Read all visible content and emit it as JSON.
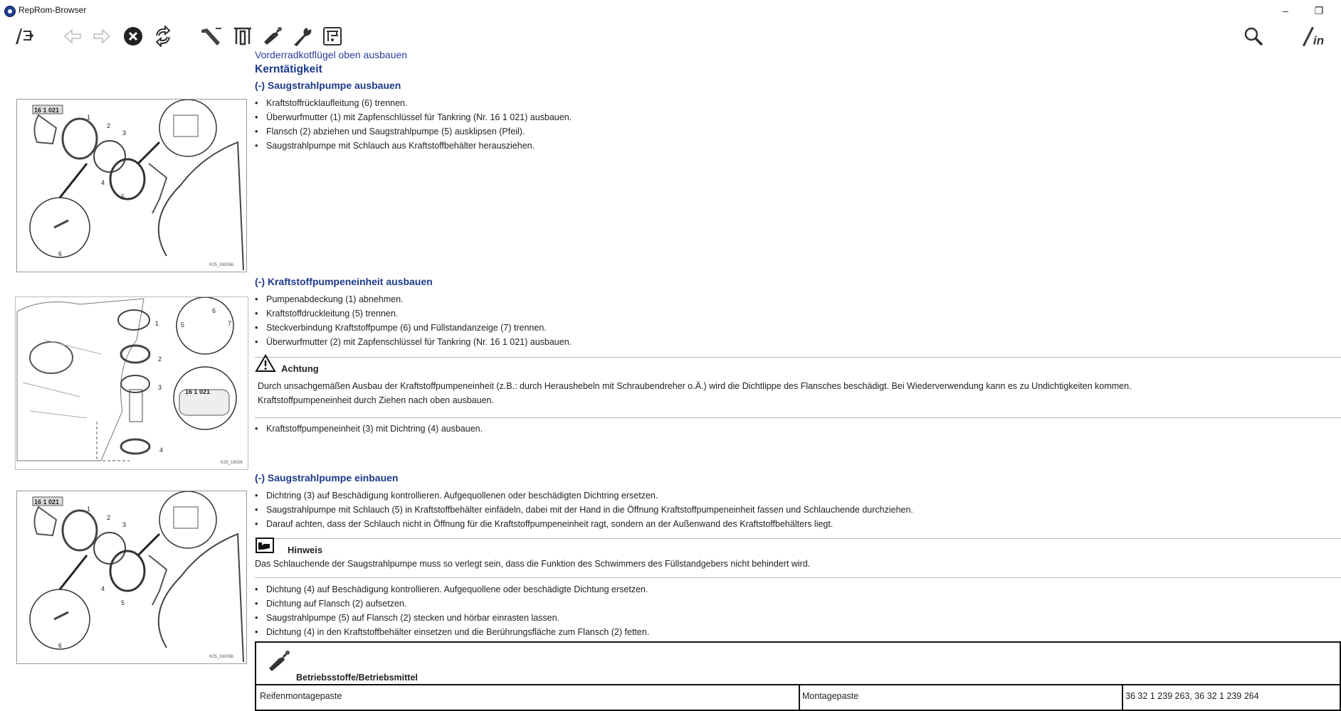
{
  "window": {
    "title": "RepRom-Browser",
    "minimize": "–",
    "restore": "❐"
  },
  "toolbar": {
    "icons": [
      "exit-icon",
      "back-arrow-icon",
      "forward-arrow-icon",
      "stop-icon",
      "refresh-icon",
      "tool1-icon",
      "tool2-icon",
      "grease-gun-icon",
      "wrench-icon",
      "specs-icon",
      "search-icon",
      "info-pen-icon"
    ]
  },
  "page": {
    "breadcrumb": "Vorderradkotflügel oben ausbauen",
    "heading": "Kerntätigkeit",
    "sections": [
      {
        "title": "(-) Saugstrahlpumpe ausbauen",
        "bullets": [
          "Kraftstoffrücklaufleitung (6) trennen.",
          "Überwurfmutter (1) mit Zapfenschlüssel für Tankring (Nr. 16 1 021) ausbauen.",
          "Flansch (2) abziehen und Saugstrahlpumpe (5) ausklipsen (Pfeil).",
          "Saugstrahlpumpe mit Schlauch aus Kraftstoffbehälter herausziehen."
        ]
      },
      {
        "title": "(-) Kraftstoffpumpeneinheit ausbauen",
        "bullets": [
          "Pumpenabdeckung (1) abnehmen.",
          "Kraftstoffdruckleitung (5) trennen.",
          "Steckverbindung Kraftstoffpumpe (6) und Füllstandanzeige (7) trennen.",
          "Überwurfmutter (2) mit Zapfenschlüssel für Tankring (Nr. 16 1 021) ausbauen."
        ],
        "warning": {
          "label": "Achtung",
          "line1": "Durch unsachgemäßen Ausbau der Kraftstoffpumpeneinheit (z.B.: durch Heraushebeln mit Schraubendreher o.Ä.) wird die Dichtlippe des Flansches beschädigt. Bei Wiederverwendung kann es zu Undichtigkeiten kommen.",
          "line2": "Kraftstoffpumpeneinheit durch Ziehen nach oben ausbauen."
        },
        "after": "Kraftstoffpumpeneinheit (3) mit Dichtring (4) ausbauen."
      },
      {
        "title": "(-) Saugstrahlpumpe einbauen",
        "bullets": [
          "Dichtring (3) auf Beschädigung kontrollieren. Aufgequollenen oder beschädigten Dichtring ersetzen.",
          "Saugstrahlpumpe mit Schlauch (5) in Kraftstoffbehälter einfädeln, dabei mit der Hand in die Öffnung Kraftstoffpumpeneinheit fassen und Schlauchende durchziehen.",
          "Darauf achten, dass der Schlauch nicht in Öffnung für die Kraftstoffpumpeneinheit ragt, sondern an der Außenwand des Kraftstoffbehälters liegt."
        ],
        "note": {
          "label": "Hinweis",
          "text": "Das Schlauchende der Saugstrahlpumpe muss so verlegt sein, dass die Funktion des Schwimmers des Füllstandgebers nicht behindert wird."
        },
        "after_bullets": [
          "Dichtung (4) auf Beschädigung kontrollieren. Aufgequollene oder beschädigte Dichtung ersetzen.",
          "Dichtung auf Flansch (2) aufsetzen.",
          "Saugstrahlpumpe (5) auf Flansch (2) stecken und hörbar einrasten lassen.",
          "Dichtung (4) in den Kraftstoffbehälter einsetzen und die Berührungsfläche zum Flansch (2) fetten."
        ]
      }
    ],
    "materials": {
      "title": "Betriebsstoffe/Betriebsmittel",
      "row": [
        "Reifenmontagepaste",
        "Montagepaste",
        "36 32 1 239 263, 36 32 1 239 264"
      ]
    },
    "figures": [
      {
        "tag": "16 1 021",
        "code": "K25_16026b",
        "labels": [
          "1",
          "2",
          "3",
          "4",
          "5",
          "6"
        ]
      },
      {
        "tag": "16 1 021",
        "code": "K25_16026",
        "labels": [
          "1",
          "2",
          "3",
          "4",
          "5",
          "6",
          "7"
        ]
      },
      {
        "tag": "16 1 021",
        "code": "K25_16026b",
        "labels": [
          "1",
          "2",
          "3",
          "4",
          "5",
          "6"
        ]
      }
    ]
  }
}
